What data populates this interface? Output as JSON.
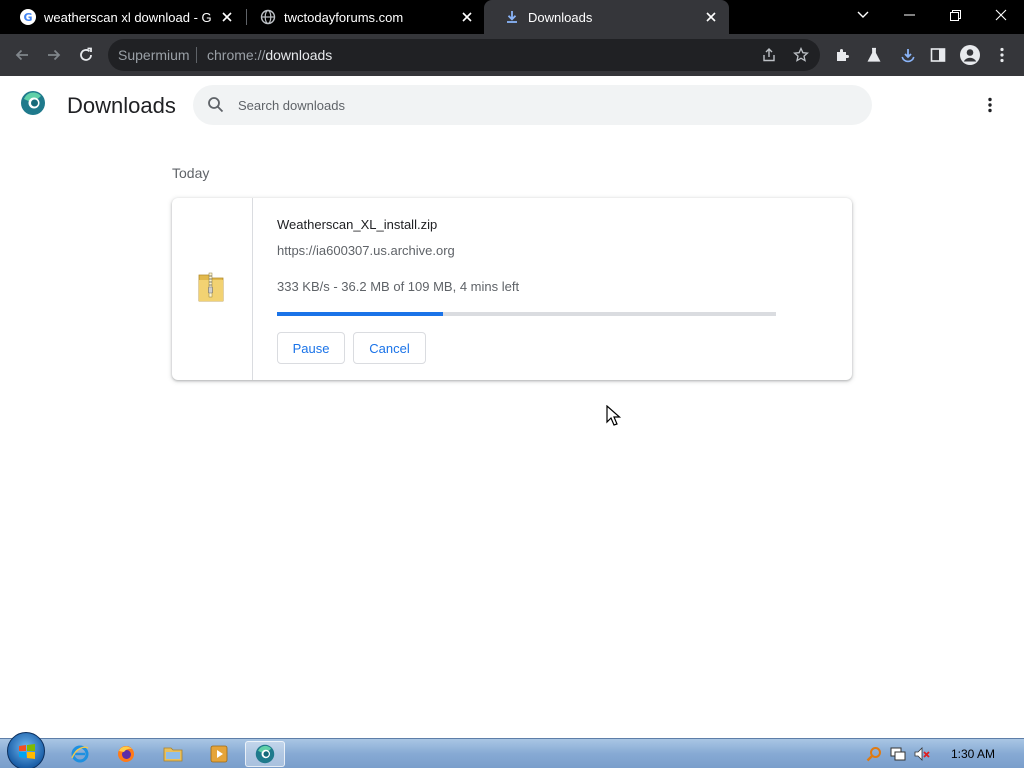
{
  "tabs": [
    {
      "title": "weatherscan xl download - Goog",
      "icon": "google-icon",
      "active": false
    },
    {
      "title": "twctodayforums.com",
      "icon": "globe-icon",
      "active": false
    },
    {
      "title": "Downloads",
      "icon": "download-icon",
      "active": true
    }
  ],
  "omnibox": {
    "brand": "Supermium",
    "scheme": "chrome://",
    "host": "downloads"
  },
  "header": {
    "title": "Downloads",
    "search_placeholder": "Search downloads"
  },
  "section": {
    "label": "Today"
  },
  "download": {
    "file_name": "Weatherscan_XL_install.zip",
    "url": "https://ia600307.us.archive.org",
    "status": "333 KB/s - 36.2 MB of 109 MB, 4 mins left",
    "progress": 0.332,
    "pause_label": "Pause",
    "cancel_label": "Cancel"
  },
  "taskbar": {
    "clock": "1:30 AM"
  },
  "colors": {
    "accent": "#1a73e8",
    "tabstrip": "#000000",
    "toolbar": "#35363a",
    "omnibox": "#202124"
  }
}
